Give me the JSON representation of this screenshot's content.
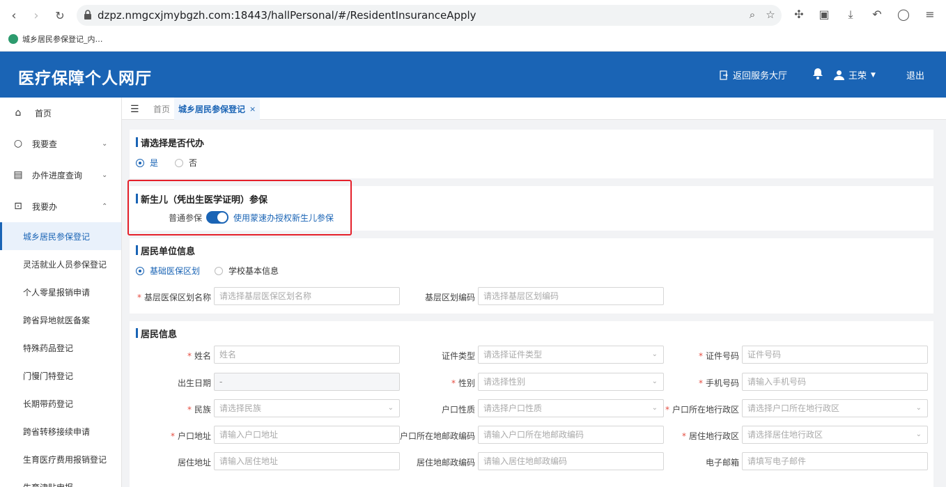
{
  "browser": {
    "url": "dzpz.nmgcxjmybgzh.com:18443/hallPersonal/#/ResidentInsuranceApply",
    "bookmark": "城乡居民参保登记_内…"
  },
  "header": {
    "title": "医疗保障个人网厅",
    "back_label": "返回服务大厅",
    "user_name": "王荣",
    "logout_label": "退出",
    "brand_color": "#1a64b5"
  },
  "sidebar": {
    "items": [
      {
        "label": "首页",
        "icon": "home-icon"
      },
      {
        "label": "我要查",
        "icon": "search-icon"
      },
      {
        "label": "办件进度查询",
        "icon": "progress-icon"
      },
      {
        "label": "我要办",
        "icon": "folder-icon"
      }
    ],
    "sub_items": [
      "城乡居民参保登记",
      "灵活就业人员参保登记",
      "个人零星报销申请",
      "跨省异地就医备案",
      "特殊药品登记",
      "门慢门特登记",
      "长期带药登记",
      "跨省转移接续申请",
      "生育医疗费用报销登记",
      "生育津贴申报"
    ]
  },
  "tabs": {
    "home": "首页",
    "active": "城乡居民参保登记",
    "close": "×"
  },
  "section_proxy": {
    "title": "请选择是否代办",
    "options": [
      "是",
      "否"
    ]
  },
  "section_newborn": {
    "title": "新生儿（凭出生医学证明）参保",
    "left_label": "普通参保",
    "right_label": "使用蒙速办授权新生儿参保"
  },
  "section_unit": {
    "title": "居民单位信息",
    "options": [
      "基础医保区划",
      "学校基本信息"
    ],
    "fields": [
      {
        "label": "基层医保区划名称",
        "placeholder": "请选择基层医保区划名称"
      },
      {
        "label": "基层区划编码",
        "placeholder": "请选择基层区划编码"
      }
    ]
  },
  "section_resident": {
    "title": "居民信息",
    "fields": [
      {
        "label": "姓名",
        "placeholder": "姓名"
      },
      {
        "label": "证件类型",
        "placeholder": "请选择证件类型"
      },
      {
        "label": "证件号码",
        "placeholder": "证件号码"
      },
      {
        "label": "出生日期",
        "placeholder": "-"
      },
      {
        "label": "性别",
        "placeholder": "请选择性别"
      },
      {
        "label": "手机号码",
        "placeholder": "请输入手机号码"
      },
      {
        "label": "民族",
        "placeholder": "请选择民族"
      },
      {
        "label": "户口性质",
        "placeholder": "请选择户口性质"
      },
      {
        "label": "户口所在地行政区",
        "placeholder": "请选择户口所在地行政区"
      },
      {
        "label": "户口地址",
        "placeholder": "请输入户口地址"
      },
      {
        "label": "户口所在地邮政编码",
        "placeholder": "请输入户口所在地邮政编码"
      },
      {
        "label": "居住地行政区",
        "placeholder": "请选择居住地行政区"
      },
      {
        "label": "居住地址",
        "placeholder": "请输入居住地址"
      },
      {
        "label": "居住地邮政编码",
        "placeholder": "请输入居住地邮政编码"
      },
      {
        "label": "电子邮箱",
        "placeholder": "请填写电子邮件"
      }
    ]
  },
  "required_mark": "*"
}
